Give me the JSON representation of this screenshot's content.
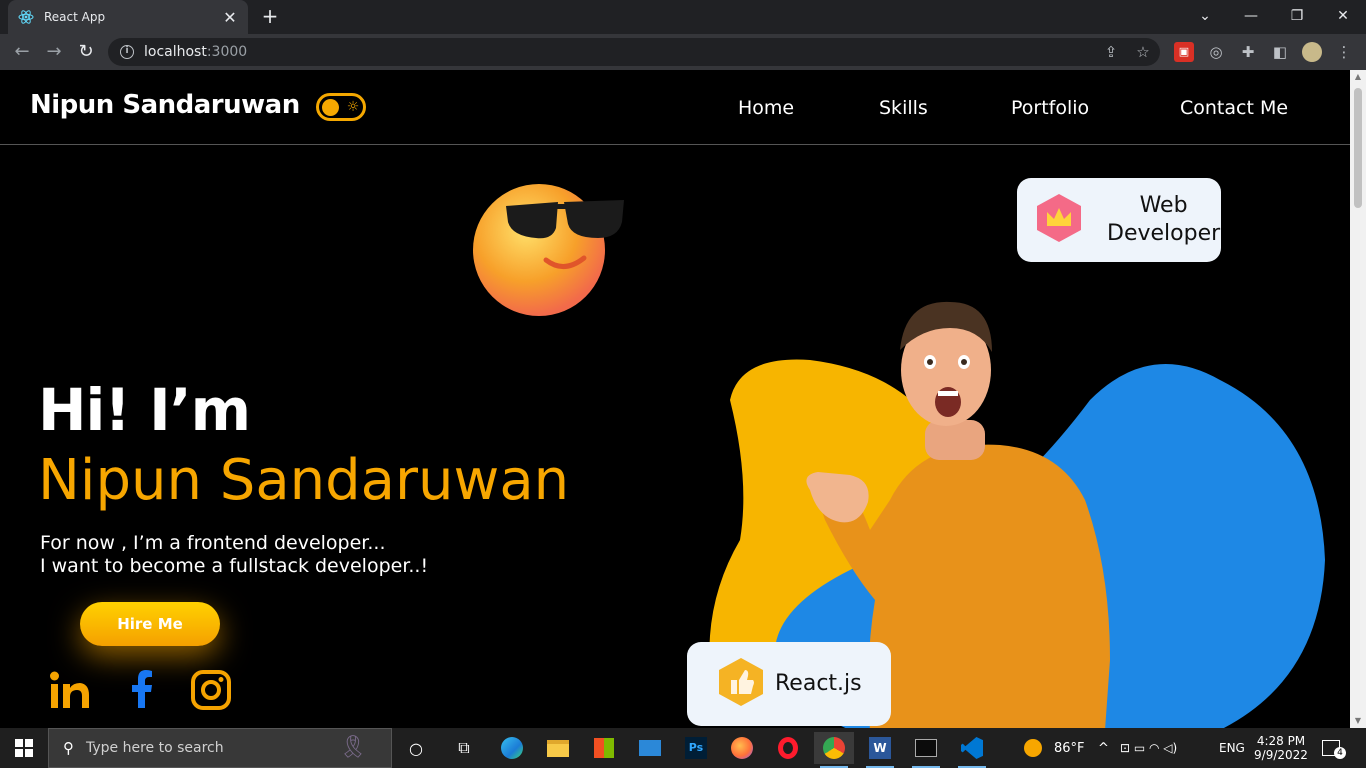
{
  "browser": {
    "tab_title": "React App",
    "tab_close": "✕",
    "new_tab": "+",
    "url_host": "localhost",
    "url_port": ":3000",
    "window_controls": [
      "⌄",
      "—",
      "❐",
      "✕"
    ]
  },
  "site": {
    "brand": "Nipun Sandaruwan",
    "nav": [
      "Home",
      "Skills",
      "Portfolio",
      "Contact Me"
    ]
  },
  "hero": {
    "greeting": "Hi! I’m",
    "name": "Nipun Sandaruwan",
    "line1": "For now , I’m a frontend developer...",
    "line2": "I want to become a fullstack developer..!",
    "cta": "Hire Me"
  },
  "badges": {
    "web_line1": "Web",
    "web_line2": "Developer",
    "react": "React.js"
  },
  "social": [
    "linkedin-icon",
    "facebook-icon",
    "instagram-icon"
  ],
  "colors": {
    "accent": "#f7a600",
    "blob_yellow": "#f7b500",
    "blob_blue": "#1e88e5",
    "background": "#000000"
  },
  "taskbar": {
    "search_placeholder": "Type here to search",
    "weather": "86°F",
    "lang": "ENG",
    "time": "4:28 PM",
    "date": "9/9/2022",
    "notifications": "4"
  }
}
